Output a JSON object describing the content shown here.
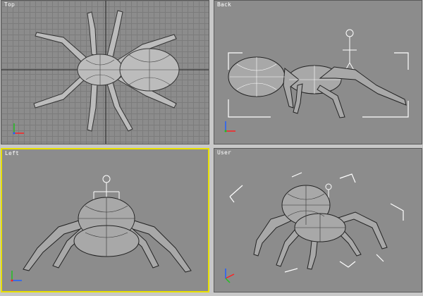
{
  "viewports": {
    "top": {
      "label": "Top"
    },
    "back": {
      "label": "Back"
    },
    "left": {
      "label": "Left"
    },
    "user": {
      "label": "User"
    }
  },
  "active_viewport": "Left",
  "colors": {
    "viewport_bg": "#8c8c8c",
    "grid": "#7c7c7c",
    "active_border": "#e8e000",
    "axis_x": "#ff2020",
    "axis_y": "#20c020",
    "axis_z": "#2060ff",
    "wire": "#ffffff"
  }
}
